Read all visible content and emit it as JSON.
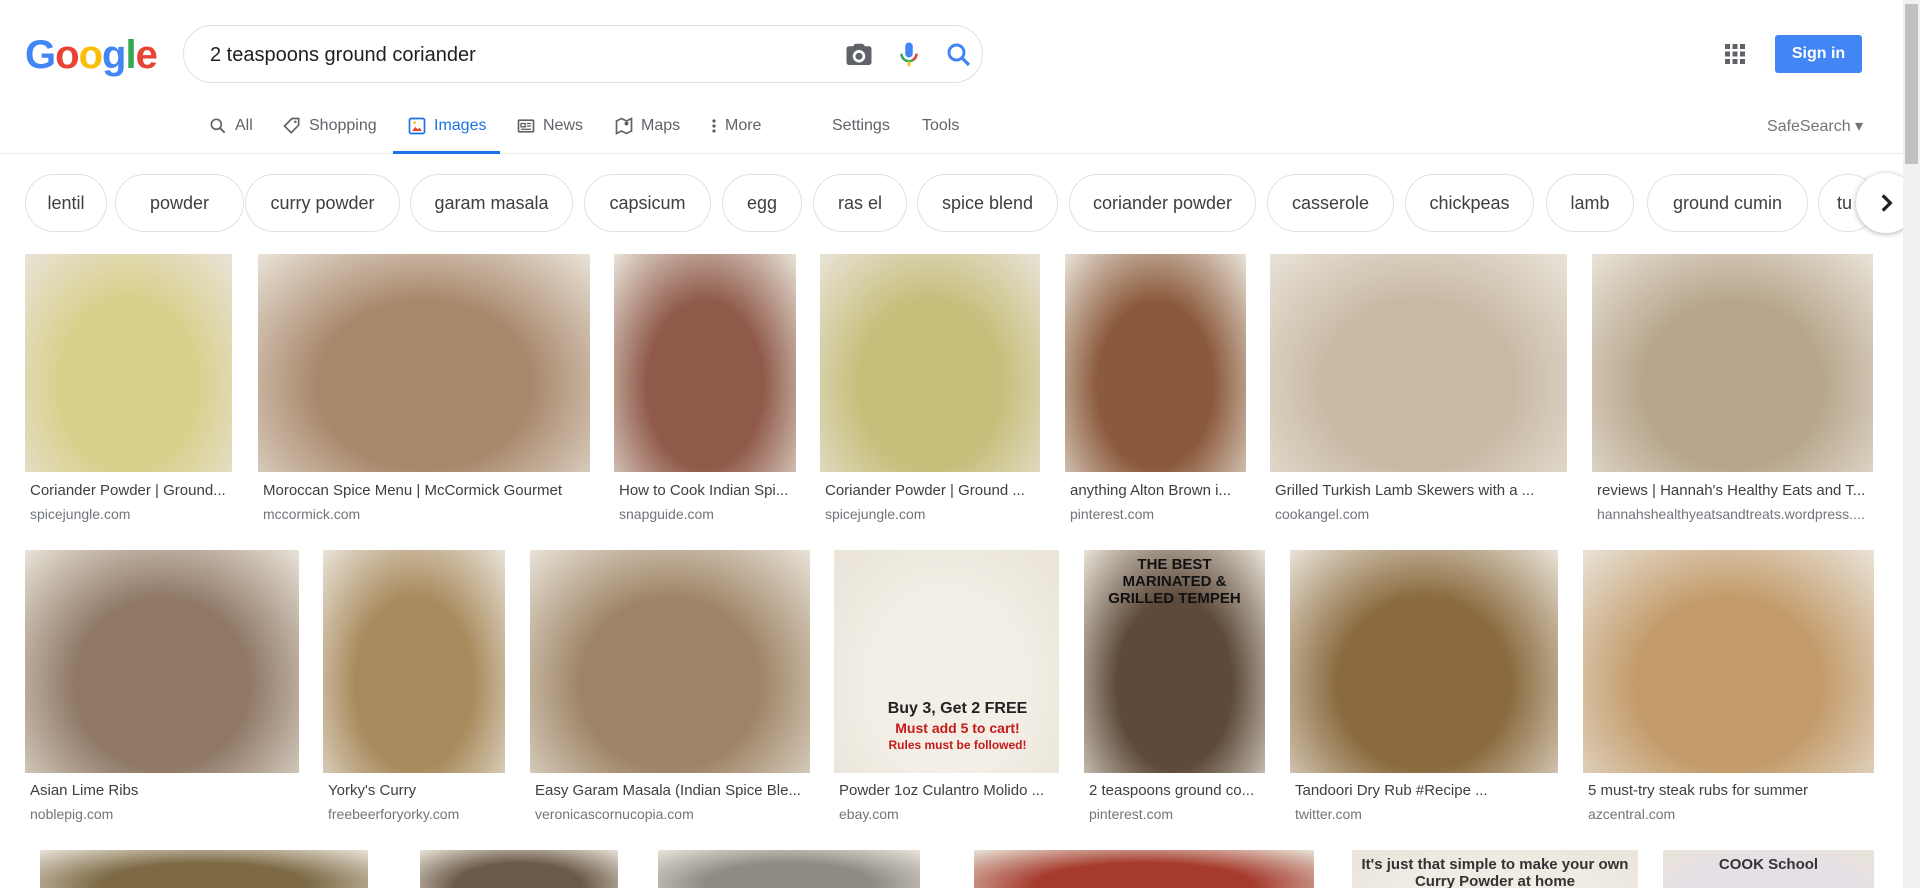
{
  "logo": {
    "letters": [
      "G",
      "o",
      "o",
      "g",
      "l",
      "e"
    ],
    "colors": [
      "#4285f4",
      "#ea4335",
      "#fbbc05",
      "#4285f4",
      "#34a853",
      "#ea4335"
    ]
  },
  "search": {
    "query": "2 teaspoons ground coriander"
  },
  "header": {
    "signin_label": "Sign in",
    "safesearch_label": "SafeSearch ▾"
  },
  "tabs": [
    {
      "label": "All",
      "icon": "search-icon"
    },
    {
      "label": "Shopping",
      "icon": "tag-icon"
    },
    {
      "label": "Images",
      "icon": "image-icon",
      "active": true
    },
    {
      "label": "News",
      "icon": "news-icon"
    },
    {
      "label": "Maps",
      "icon": "map-icon"
    },
    {
      "label": "More",
      "icon": "more-vert-icon"
    },
    {
      "label": "Settings"
    },
    {
      "label": "Tools"
    }
  ],
  "chips": [
    "lentil",
    "powder",
    "curry powder",
    "garam masala",
    "capsicum",
    "egg",
    "ras el",
    "spice blend",
    "coriander powder",
    "casserole",
    "chickpeas",
    "lamb",
    "ground cumin",
    "tu"
  ],
  "results_row1": [
    {
      "caption": "Coriander Powder | Ground...",
      "source": "spicejungle.com",
      "color": "#d8cf8a"
    },
    {
      "caption": "Moroccan Spice Menu | McCormick Gourmet",
      "source": "mccormick.com",
      "color": "#a8876b"
    },
    {
      "caption": "How to Cook Indian Spi...",
      "source": "snapguide.com",
      "color": "#8f5a4a"
    },
    {
      "caption": "Coriander Powder | Ground ...",
      "source": "spicejungle.com",
      "color": "#c6be7a"
    },
    {
      "caption": "anything Alton Brown i...",
      "source": "pinterest.com",
      "color": "#8b5a3c"
    },
    {
      "caption": "Grilled Turkish Lamb Skewers with a ...",
      "source": "cookangel.com",
      "color": "#c8b9a4"
    },
    {
      "caption": "reviews | Hannah's Healthy Eats and T...",
      "source": "hannahshealthyeatsandtreats.wordpress....",
      "color": "#b7a68c"
    }
  ],
  "results_row2": [
    {
      "caption": "Asian Lime Ribs",
      "source": "noblepig.com",
      "color": "#8f7866"
    },
    {
      "caption": "Yorky's Curry",
      "source": "freebeerforyorky.com",
      "color": "#a88a5c"
    },
    {
      "caption": "Easy Garam Masala (Indian Spice Ble...",
      "source": "veronicascornucopia.com",
      "color": "#9e8466"
    },
    {
      "caption": "Powder 1oz Culantro Molido ...",
      "source": "ebay.com",
      "color": "#f3efe6",
      "overlay": "Buy 3, Get 2 FREE",
      "overlay2": "Must add 5 to cart!",
      "overlay3": "Rules must be followed!"
    },
    {
      "caption": "2 teaspoons ground co...",
      "source": "pinterest.com",
      "color": "#5d4a3a",
      "overlay": "THE BEST MARINATED & GRILLED TEMPEH"
    },
    {
      "caption": "Tandoori Dry Rub #Recipe ...",
      "source": "twitter.com",
      "color": "#8a6a3e"
    },
    {
      "caption": "5 must-try steak rubs for summer",
      "source": "azcentral.com",
      "color": "#c39b6a"
    }
  ],
  "results_row3": [
    {
      "color": "#7d6a45"
    },
    {
      "color": "#6b5a48"
    },
    {
      "color": "#8e8a84"
    },
    {
      "color": "#a53b2c"
    },
    {
      "color": "#f0ece4",
      "overlay": "It's just that simple to make your own Curry Powder at home"
    },
    {
      "color": "#e6dfe8",
      "overlay": "COOK School"
    }
  ]
}
